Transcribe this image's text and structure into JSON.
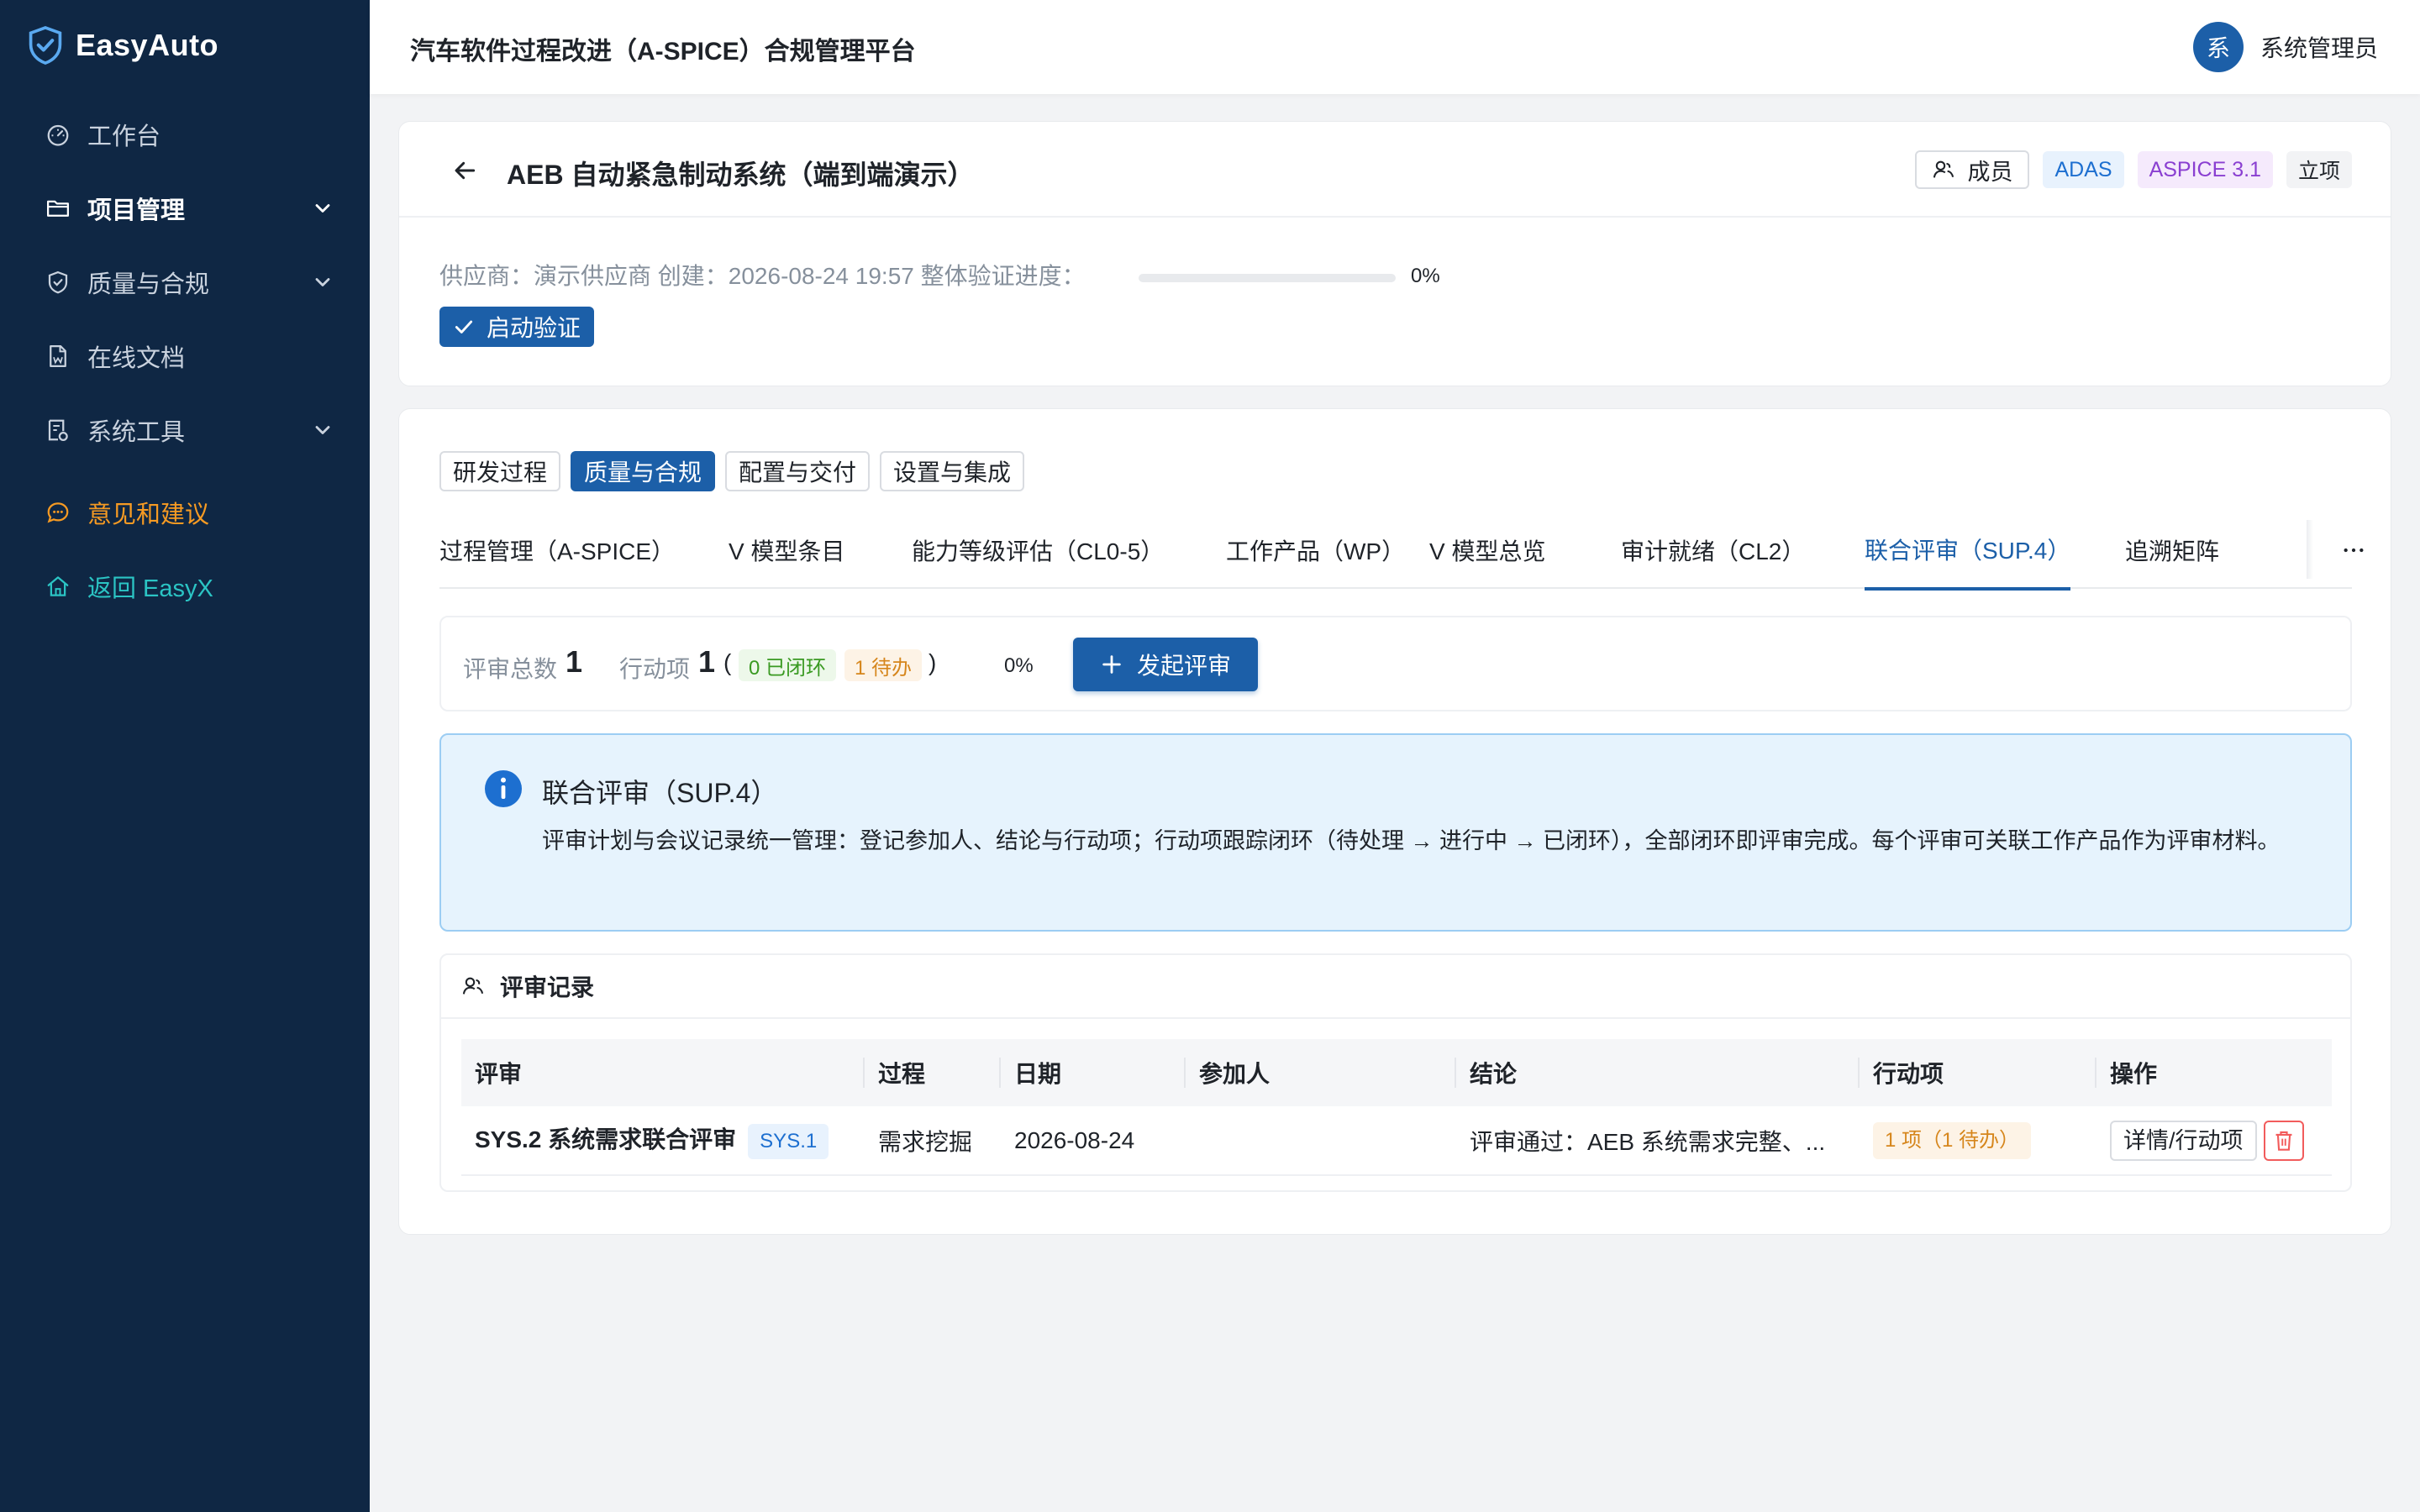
{
  "app": {
    "name": "EasyAuto",
    "platform_title": "汽车软件过程改进（A-SPICE）合规管理平台"
  },
  "user": {
    "avatar_char": "系",
    "name": "系统管理员"
  },
  "sidebar": {
    "items": [
      {
        "label": "工作台",
        "icon": "dashboard-icon"
      },
      {
        "label": "项目管理",
        "icon": "folder-icon",
        "expandable": true
      },
      {
        "label": "质量与合规",
        "icon": "shield-check-icon",
        "expandable": true
      },
      {
        "label": "在线文档",
        "icon": "document-icon"
      },
      {
        "label": "系统工具",
        "icon": "tools-icon",
        "expandable": true
      },
      {
        "label": "意见和建议",
        "icon": "chat-icon"
      },
      {
        "label": "返回 EasyX",
        "icon": "home-icon"
      }
    ]
  },
  "project": {
    "title": "AEB 自动紧急制动系统（端到端演示）",
    "member_button": "成员",
    "tags": [
      "ADAS",
      "ASPICE 3.1",
      "立项"
    ],
    "meta": "供应商：演示供应商  创建：2026-08-24 19:57  整体验证进度：",
    "progress": 0,
    "progress_text": "0%",
    "verify_button": "启动验证"
  },
  "segment_tabs": [
    "研发过程",
    "质量与合规",
    "配置与交付",
    "设置与集成"
  ],
  "active_segment": 1,
  "sub_tabs": [
    "过程管理（A-SPICE）",
    "V 模型条目",
    "能力等级评估（CL0-5）",
    "工作产品（WP）",
    "V 模型总览",
    "审计就绪（CL2）",
    "联合评审（SUP.4）",
    "追溯矩阵"
  ],
  "active_sub_tab": 6,
  "stats": {
    "review_total_label": "评审总数",
    "review_total": "1",
    "action_label": "行动项",
    "action_total": "1",
    "paren_open": "(",
    "paren_close": ")",
    "closed_tag": "0 已闭环",
    "pending_tag": "1 待办",
    "closure_rate": 0,
    "percent": "0%",
    "start_button": "发起评审"
  },
  "info": {
    "title": "联合评审（SUP.4）",
    "text": "评审计划与会议记录统一管理：登记参加人、结论与行动项；行动项跟踪闭环（待处理 → 进行中 → 已闭环），全部闭环即评审完成。每个评审可关联工作产品作为评审材料。"
  },
  "records": {
    "title": "评审记录",
    "columns": [
      "评审",
      "过程",
      "日期",
      "参加人",
      "结论",
      "行动项",
      "操作"
    ],
    "rows": [
      {
        "title": "SYS.2 系统需求联合评审",
        "tag": "SYS.1",
        "process": "需求挖掘",
        "date": "2026-08-24",
        "participants": "",
        "conclusion": "评审通过：AEB 系统需求完整、...",
        "action": "1 项（1 待办）",
        "detail_button": "详情/行动项"
      }
    ]
  },
  "colors": {
    "sidebar": "#0f2744",
    "primary": "#1c5fa8",
    "danger": "#f25c5c"
  }
}
